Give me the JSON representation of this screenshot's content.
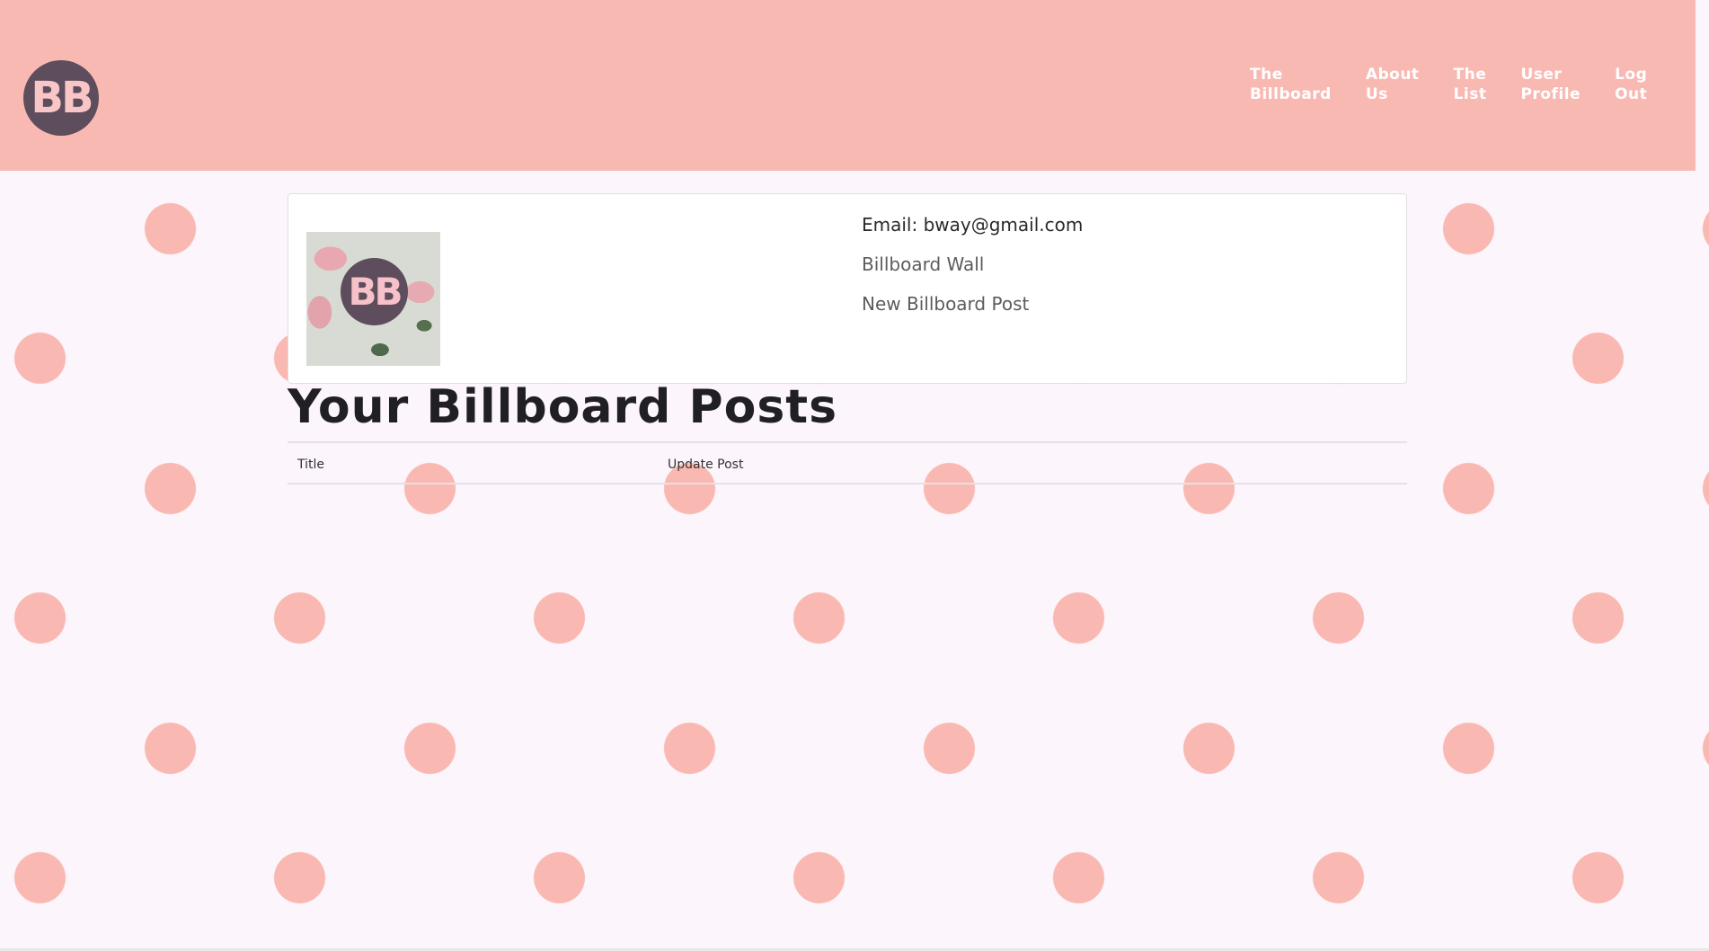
{
  "navbar": {
    "logo_text": "BB",
    "links": [
      {
        "label": "The\nBillboard"
      },
      {
        "label": "About\nUs"
      },
      {
        "label": "The\nList"
      },
      {
        "label": "User\nProfile"
      },
      {
        "label": "Log\nOut"
      }
    ]
  },
  "profile": {
    "image_logo_text": "BB",
    "email_line": "Email: bway@gmail.com",
    "links": [
      {
        "label": "Billboard Wall"
      },
      {
        "label": "New Billboard Post"
      }
    ]
  },
  "page": {
    "title": "Your Billboard Posts"
  },
  "table": {
    "columns": [
      "Title",
      "Update Post"
    ],
    "rows": []
  },
  "colors": {
    "navbar_bg": "#f9b9b3",
    "dot": "#f9b8b1",
    "page_bg": "#fcf5fb",
    "logo_bg": "#5e4d5c",
    "logo_text": "#f9c6c8"
  }
}
